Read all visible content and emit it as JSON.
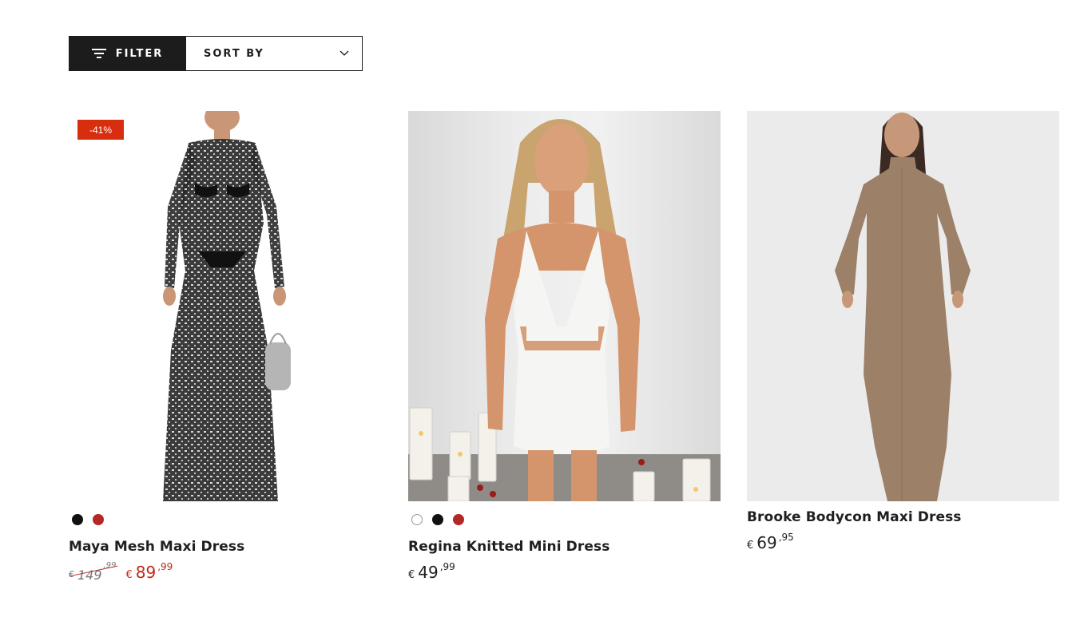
{
  "toolbar": {
    "filter_label": "FILTER",
    "sort_label": "SORT BY",
    "filter_icon": "filter-lines-icon",
    "sort_icon": "chevron-down-icon"
  },
  "colors": {
    "dark": "#1c1c1c",
    "sale_badge": "#d72e10",
    "sale_price": "#c02a18",
    "swatch_black": "#111111",
    "swatch_red": "#b32727",
    "swatch_white": "#ffffff"
  },
  "products": [
    {
      "name": "Maya Mesh Maxi Dress",
      "badge": "-41%",
      "image": "model in black sequin mesh maxi dress",
      "swatches": [
        "black",
        "red"
      ],
      "old_price": {
        "currency": "€",
        "int": "149",
        "dec": ",99"
      },
      "price": {
        "currency": "€",
        "int": "89",
        "dec": ",99"
      }
    },
    {
      "name": "Regina Knitted Mini Dress",
      "image": "model in white knitted mini dress with candles",
      "swatches": [
        "white",
        "black",
        "red"
      ],
      "price": {
        "currency": "€",
        "int": "49",
        "dec": ",99"
      }
    },
    {
      "name": "Brooke Bodycon Maxi Dress",
      "image": "model in taupe bodycon maxi dress",
      "swatches": [],
      "price": {
        "currency": "€",
        "int": "69",
        "dec": ",95"
      }
    }
  ]
}
